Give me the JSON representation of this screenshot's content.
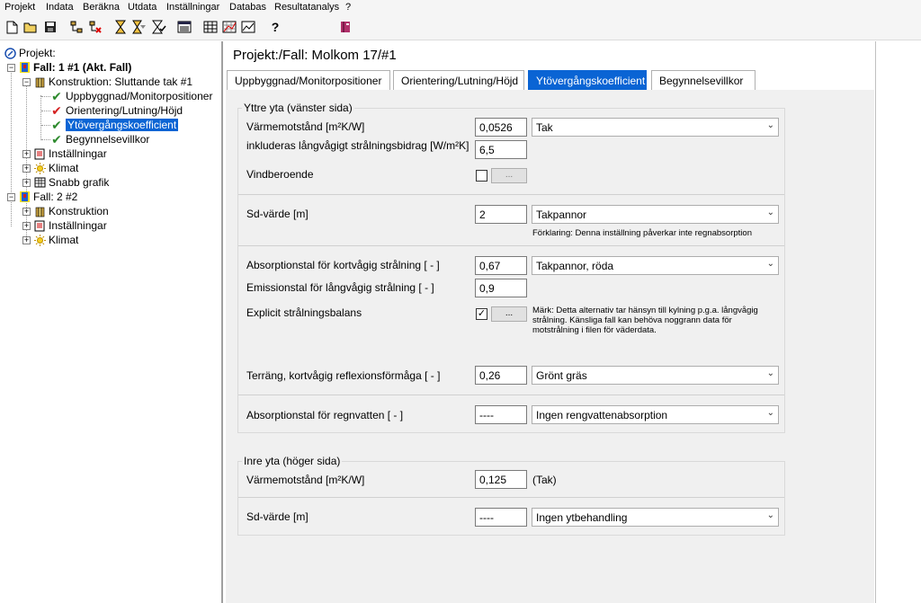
{
  "menu": [
    "Projekt",
    "Indata",
    "Beräkna",
    "Utdata",
    "Inställningar",
    "Databas",
    "Resultatanalys",
    "?"
  ],
  "toolbar": {
    "icons": [
      "new-document-icon",
      "open-folder-icon",
      "save-icon",
      "tree-add-icon",
      "tree-remove-icon",
      "hourglass-icon",
      "hourglass-multi-icon",
      "hourglass-check-icon",
      "list-window-icon",
      "grid-icon",
      "chart-grid-icon",
      "chart-check-icon",
      "help-icon",
      "book-icon"
    ],
    "help_label": "?"
  },
  "tree": {
    "root": "Projekt:",
    "case1": "Fall: 1 #1 (Akt. Fall)",
    "construction1": "Konstruktion: Sluttande tak #1",
    "item_build": "Uppbyggnad/Monitorpositioner",
    "item_orient": "Orientering/Lutning/Höjd",
    "item_surface": "Ytövergångskoefficient",
    "item_initial": "Begynnelsevillkor",
    "settings1": "Inställningar",
    "climate1": "Klimat",
    "quickgraph": "Snabb grafik",
    "case2": "Fall: 2 #2",
    "construction2": "Konstruktion",
    "settings2": "Inställningar",
    "climate2": "Klimat"
  },
  "page": {
    "title": "Projekt:/Fall:  Molkom 17/#1",
    "tabs": [
      "Uppbyggnad/Monitorpositioner",
      "Orientering/Lutning/Höjd",
      "Ytövergångskoefficient",
      "Begynnelsevillkor"
    ],
    "active_tab": 2
  },
  "outer": {
    "title": "Yttre yta (vänster sida)",
    "resistance_label": "Värmemotstånd [m²K/W]",
    "resistance_value": "0,0526",
    "resistance_select": "Tak",
    "longwave_label": "inkluderas långvågigt strålningsbidrag [W/m²K]",
    "longwave_value": "6,5",
    "wind_label": "Vindberoende",
    "wind_checked": false,
    "wind_button": "...",
    "sd_label": "Sd-värde  [m]",
    "sd_value": "2",
    "sd_select": "Takpannor",
    "sd_note": "Förklaring: Denna inställning påverkar inte regnabsorption",
    "abs_label": "Absorptionstal för kortvågig strålning [ - ]",
    "abs_value": "0,67",
    "abs_select": "Takpannor, röda",
    "emis_label": "Emissionstal för långvågig strålning [ - ]",
    "emis_value": "0,9",
    "explicit_label": "Explicit strålningsbalans",
    "explicit_checked": true,
    "explicit_button": "...",
    "explicit_note": "Märk: Detta alternativ tar hänsyn till kylning p.g.a. långvågig strålning. Känsliga fall kan behöva noggrann data för motstrålning i filen för väderdata.",
    "terrain_label": "Terräng, kortvågig reflexionsförmåga [ - ]",
    "terrain_value": "0,26",
    "terrain_select": "Grönt gräs",
    "rain_label": "Absorptionstal för regnvatten [ - ]",
    "rain_value": "----",
    "rain_select": "Ingen rengvattenabsorption"
  },
  "inner": {
    "title": "Inre yta (höger sida)",
    "resistance_label": "Värmemotstånd [m²K/W]",
    "resistance_value": "0,125",
    "resistance_text": "(Tak)",
    "sd_label": "Sd-värde  [m]",
    "sd_value": "----",
    "sd_select": "Ingen ytbehandling"
  },
  "colors": {
    "selection": "#0a64d4",
    "check_green": "#2d8a2d",
    "check_red": "#d42020"
  }
}
